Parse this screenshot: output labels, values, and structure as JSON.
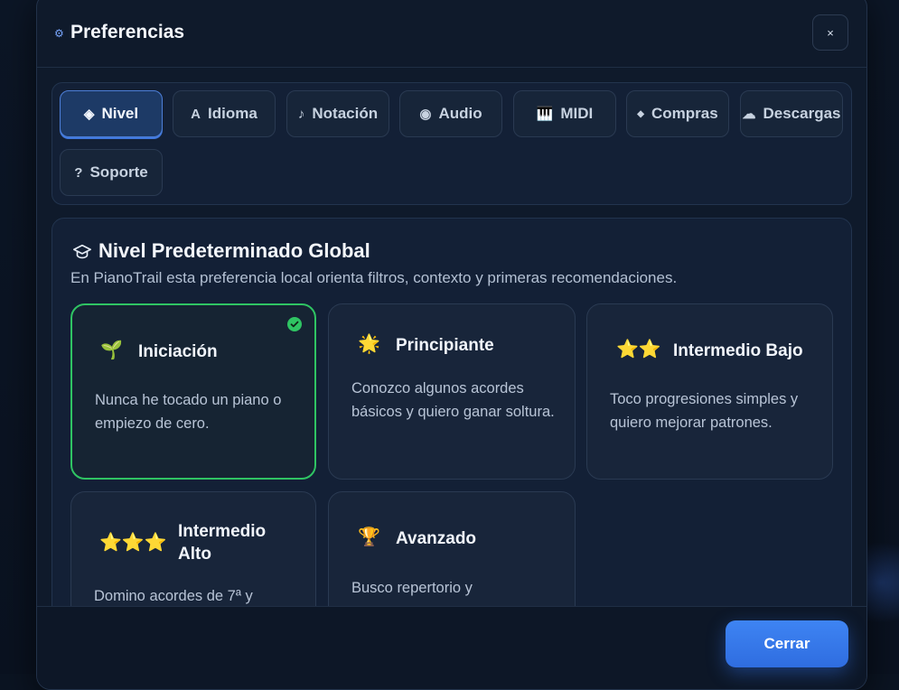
{
  "dialog": {
    "title": "Preferencias",
    "title_icon": "⚙",
    "close_label": "×"
  },
  "tabs": [
    {
      "label": "Nivel",
      "icon": "◈",
      "active": true
    },
    {
      "label": "Idioma",
      "icon": "A"
    },
    {
      "label": "Notación",
      "icon": "♪"
    },
    {
      "label": "Audio",
      "icon": "◉"
    },
    {
      "label": "MIDI",
      "icon": "🎹"
    },
    {
      "label": "Compras",
      "icon": "◆"
    },
    {
      "label": "Descargas",
      "icon": "☁"
    },
    {
      "label": "Soporte",
      "icon": "?"
    }
  ],
  "section": {
    "title": "Nivel Predeterminado Global",
    "description": "En PianoTrail esta preferencia local orienta filtros, contexto y primeras recomendaciones."
  },
  "levels": [
    {
      "name": "Iniciación",
      "emoji": "🌱",
      "description": "Nunca he tocado un piano o empiezo de cero.",
      "selected": true
    },
    {
      "name": "Principiante",
      "emoji": "🌟",
      "description": "Conozco algunos acordes básicos y quiero ganar soltura."
    },
    {
      "name": "Intermedio Bajo",
      "emoji": "⭐⭐",
      "description": "Toco progresiones simples y quiero mejorar patrones."
    },
    {
      "name": "Intermedio Alto",
      "emoji": "⭐⭐⭐",
      "description": "Domino acordes de 7ª y"
    },
    {
      "name": "Avanzado",
      "emoji": "🏆",
      "description": "Busco repertorio y"
    }
  ],
  "footer": {
    "close_button": "Cerrar"
  },
  "colors": {
    "accent": "#3e84f3",
    "selected": "#2fc463",
    "background": "#0f1a2b"
  }
}
